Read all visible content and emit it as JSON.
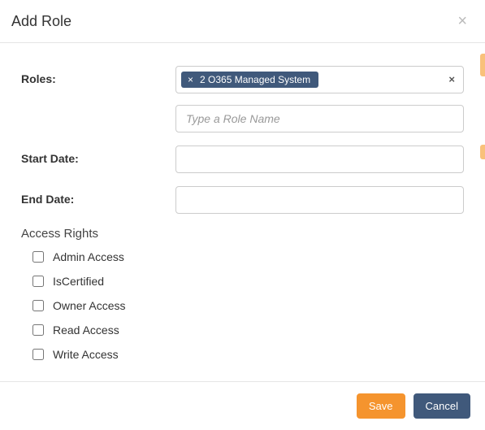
{
  "modal": {
    "title": "Add Role",
    "close_glyph": "×"
  },
  "form": {
    "roles_label": "Roles:",
    "role_chip": "2 O365 Managed System",
    "role_chip_x": "×",
    "clear_all_glyph": "×",
    "role_input_placeholder": "Type a Role Name",
    "role_input_value": "",
    "start_date_label": "Start Date:",
    "start_date_value": "",
    "end_date_label": "End Date:",
    "end_date_value": ""
  },
  "access": {
    "section_title": "Access Rights",
    "items": [
      {
        "label": "Admin Access",
        "checked": false
      },
      {
        "label": "IsCertified",
        "checked": false
      },
      {
        "label": "Owner Access",
        "checked": false
      },
      {
        "label": "Read Access",
        "checked": false
      },
      {
        "label": "Write Access",
        "checked": false
      }
    ]
  },
  "footer": {
    "save_label": "Save",
    "cancel_label": "Cancel"
  }
}
